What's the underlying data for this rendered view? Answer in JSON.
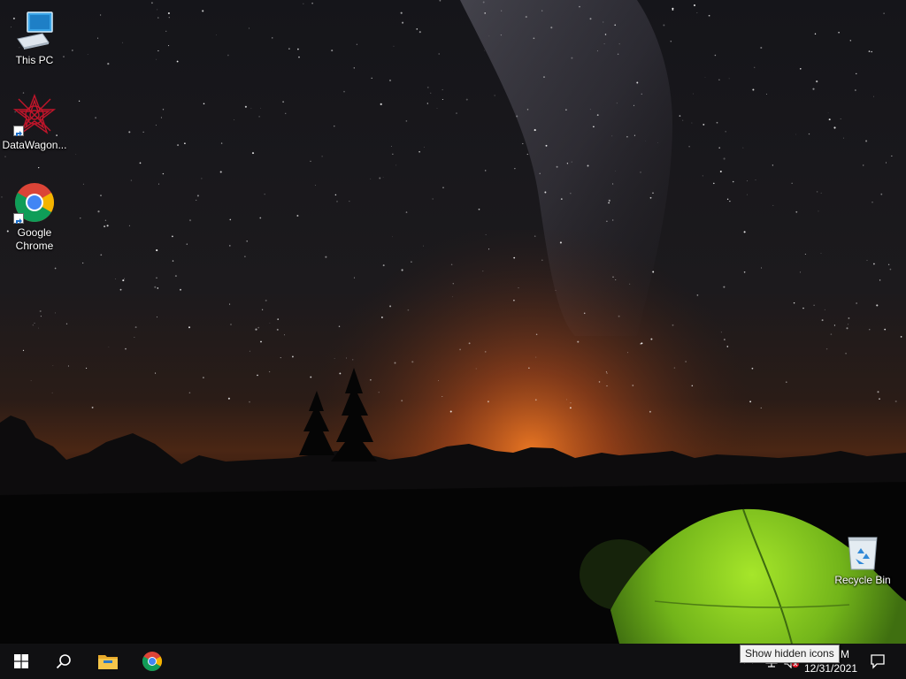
{
  "desktop": {
    "icons": [
      {
        "label": "This PC",
        "icon": "this-pc-icon"
      },
      {
        "label": "DataWagon...",
        "icon": "datawagon-icon"
      },
      {
        "label": "Google Chrome",
        "icon": "chrome-icon"
      },
      {
        "label": "Recycle Bin",
        "icon": "recycle-bin-icon"
      }
    ]
  },
  "taskbar": {
    "pinned": [
      {
        "icon": "windows-start-icon"
      },
      {
        "icon": "search-icon"
      },
      {
        "icon": "file-explorer-icon"
      },
      {
        "icon": "chrome-icon"
      }
    ],
    "tray": {
      "icons": [
        "chevron-up-icon",
        "network-icon",
        "volume-muted-icon"
      ],
      "tooltip": "Show hidden icons",
      "clock_time_visible": "M",
      "clock_date": "12/31/2021"
    }
  },
  "colors": {
    "taskbar_bg": "#101012",
    "tent_green": "#8ed21e",
    "horizon_orange": "#e0601a",
    "windows_blue": "#0078d7"
  }
}
